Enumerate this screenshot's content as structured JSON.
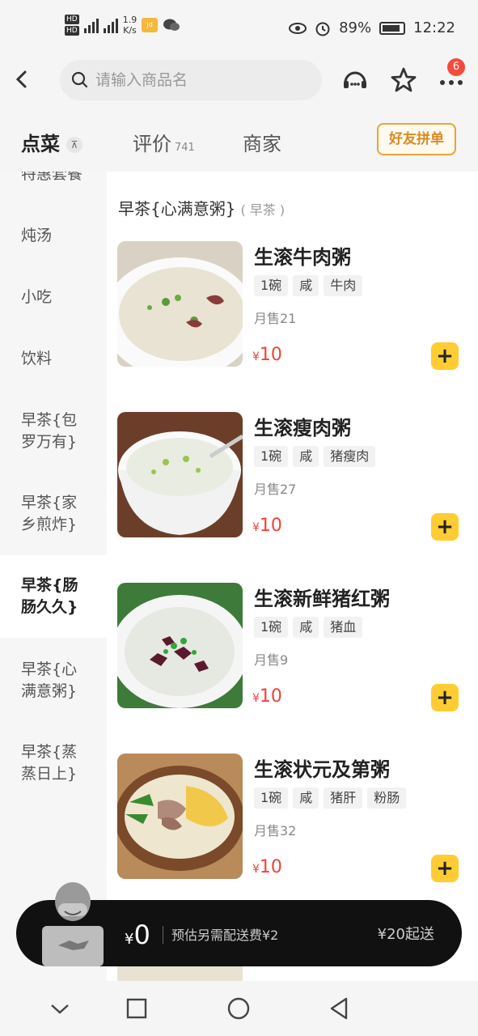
{
  "status_bar": {
    "network_speed": "1.9",
    "network_unit": "K/s",
    "battery_level": "89%",
    "battery_fraction": 0.89,
    "time": "12:22"
  },
  "header": {
    "search_placeholder": "请输入商品名",
    "more_badge": "6"
  },
  "tabs": {
    "order_label": "点菜",
    "reviews_label": "评价",
    "reviews_count": "741",
    "merchant_label": "商家",
    "group_order_label": "好友拼单"
  },
  "sidebar": {
    "categories": [
      {
        "label": "特惠套餐"
      },
      {
        "label": "炖汤"
      },
      {
        "label": "小吃"
      },
      {
        "label": "饮料"
      },
      {
        "line1": "早茶{包",
        "line2": "罗万有}"
      },
      {
        "line1": "早茶{家",
        "line2": "乡煎炸}"
      },
      {
        "line1": "早茶{肠",
        "line2": "肠久久}"
      },
      {
        "line1": "早茶{心",
        "line2": "满意粥}"
      },
      {
        "line1": "早茶{蒸",
        "line2": "蒸日上}"
      }
    ]
  },
  "section": {
    "title": "早茶{心满意粥}",
    "subtitle": "( 早茶 )"
  },
  "items": [
    {
      "name": "生滚牛肉粥",
      "tags": [
        "1碗",
        "咸",
        "牛肉"
      ],
      "sold": "月售21",
      "currency": "¥",
      "price": "10"
    },
    {
      "name": "生滚瘦肉粥",
      "tags": [
        "1碗",
        "咸",
        "猪瘦肉"
      ],
      "sold": "月售27",
      "currency": "¥",
      "price": "10"
    },
    {
      "name": "生滚新鲜猪红粥",
      "tags": [
        "1碗",
        "咸",
        "猪血"
      ],
      "sold": "月售9",
      "currency": "¥",
      "price": "10"
    },
    {
      "name": "生滚状元及第粥",
      "tags": [
        "1碗",
        "咸",
        "猪肝",
        "粉肠"
      ],
      "sold": "月售32",
      "currency": "¥",
      "price": "10"
    }
  ],
  "add_label": "+",
  "cart": {
    "currency": "¥",
    "total": "0",
    "delivery_fee_note": "预估另需配送费¥2",
    "min_order": "¥20起送"
  },
  "colors": {
    "accent": "#ffcc33",
    "price": "#f1413a",
    "badge": "#f44b3a",
    "group_order": "#e8a436"
  }
}
